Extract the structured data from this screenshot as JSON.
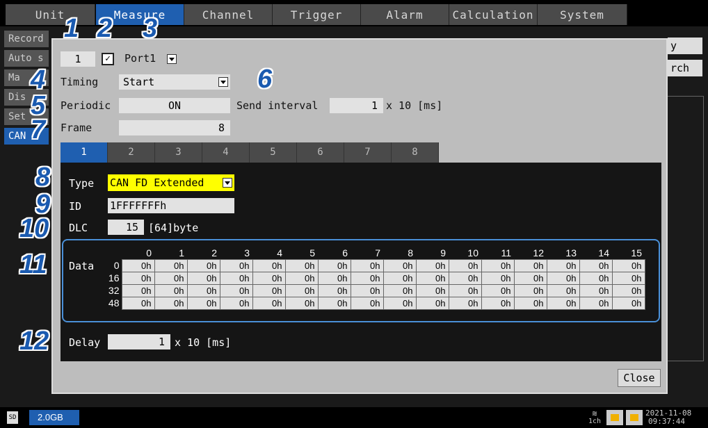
{
  "top_tabs": [
    "Unit",
    "Measure",
    "Channel",
    "Trigger",
    "Alarm",
    "Calculation",
    "System"
  ],
  "top_active": "Measure",
  "side_items": [
    "Record",
    "Auto s",
    "Ma",
    "Dis",
    "Set",
    "CAN"
  ],
  "behind_buttons": [
    "y",
    "rch"
  ],
  "status": {
    "storage": "2.0GB",
    "storage_icon": "sd-card-icon",
    "date": "2021-11-08",
    "time": "09:37:44",
    "wifi_label": "1ch"
  },
  "dialog": {
    "slot_number": "1",
    "enabled_check": "✓",
    "port": "Port1",
    "timing_label": "Timing",
    "timing_value": "Start",
    "periodic_label": "Periodic",
    "periodic_value": "ON",
    "send_interval_label": "Send interval",
    "send_interval_value": "1",
    "send_interval_unit": "x 10 [ms]",
    "frame_label": "Frame",
    "frame_value": "8",
    "frame_tabs": [
      "1",
      "2",
      "3",
      "4",
      "5",
      "6",
      "7",
      "8"
    ],
    "type_label": "Type",
    "type_value": "CAN FD Extended",
    "id_label": "ID",
    "id_value": "1FFFFFFFh",
    "dlc_label": "DLC",
    "dlc_value": "15",
    "dlc_bytes": "[64]byte",
    "data_label": "Data",
    "data_columns": [
      "0",
      "1",
      "2",
      "3",
      "4",
      "5",
      "6",
      "7",
      "8",
      "9",
      "10",
      "11",
      "12",
      "13",
      "14",
      "15"
    ],
    "data_rows": [
      {
        "offset": "0",
        "cells": [
          "0h",
          "0h",
          "0h",
          "0h",
          "0h",
          "0h",
          "0h",
          "0h",
          "0h",
          "0h",
          "0h",
          "0h",
          "0h",
          "0h",
          "0h",
          "0h"
        ]
      },
      {
        "offset": "16",
        "cells": [
          "0h",
          "0h",
          "0h",
          "0h",
          "0h",
          "0h",
          "0h",
          "0h",
          "0h",
          "0h",
          "0h",
          "0h",
          "0h",
          "0h",
          "0h",
          "0h"
        ]
      },
      {
        "offset": "32",
        "cells": [
          "0h",
          "0h",
          "0h",
          "0h",
          "0h",
          "0h",
          "0h",
          "0h",
          "0h",
          "0h",
          "0h",
          "0h",
          "0h",
          "0h",
          "0h",
          "0h"
        ]
      },
      {
        "offset": "48",
        "cells": [
          "0h",
          "0h",
          "0h",
          "0h",
          "0h",
          "0h",
          "0h",
          "0h",
          "0h",
          "0h",
          "0h",
          "0h",
          "0h",
          "0h",
          "0h",
          "0h"
        ]
      }
    ],
    "delay_label": "Delay",
    "delay_value": "1",
    "delay_unit": "x 10 [ms]",
    "close_label": "Close"
  },
  "callouts": [
    "1",
    "2",
    "3",
    "4",
    "5",
    "6",
    "7",
    "8",
    "9",
    "10",
    "11",
    "12"
  ],
  "colors": {
    "accent": "#1f5fb0",
    "highlight_yellow": "#ffff00",
    "callout_blue": "#1a5ab0"
  }
}
